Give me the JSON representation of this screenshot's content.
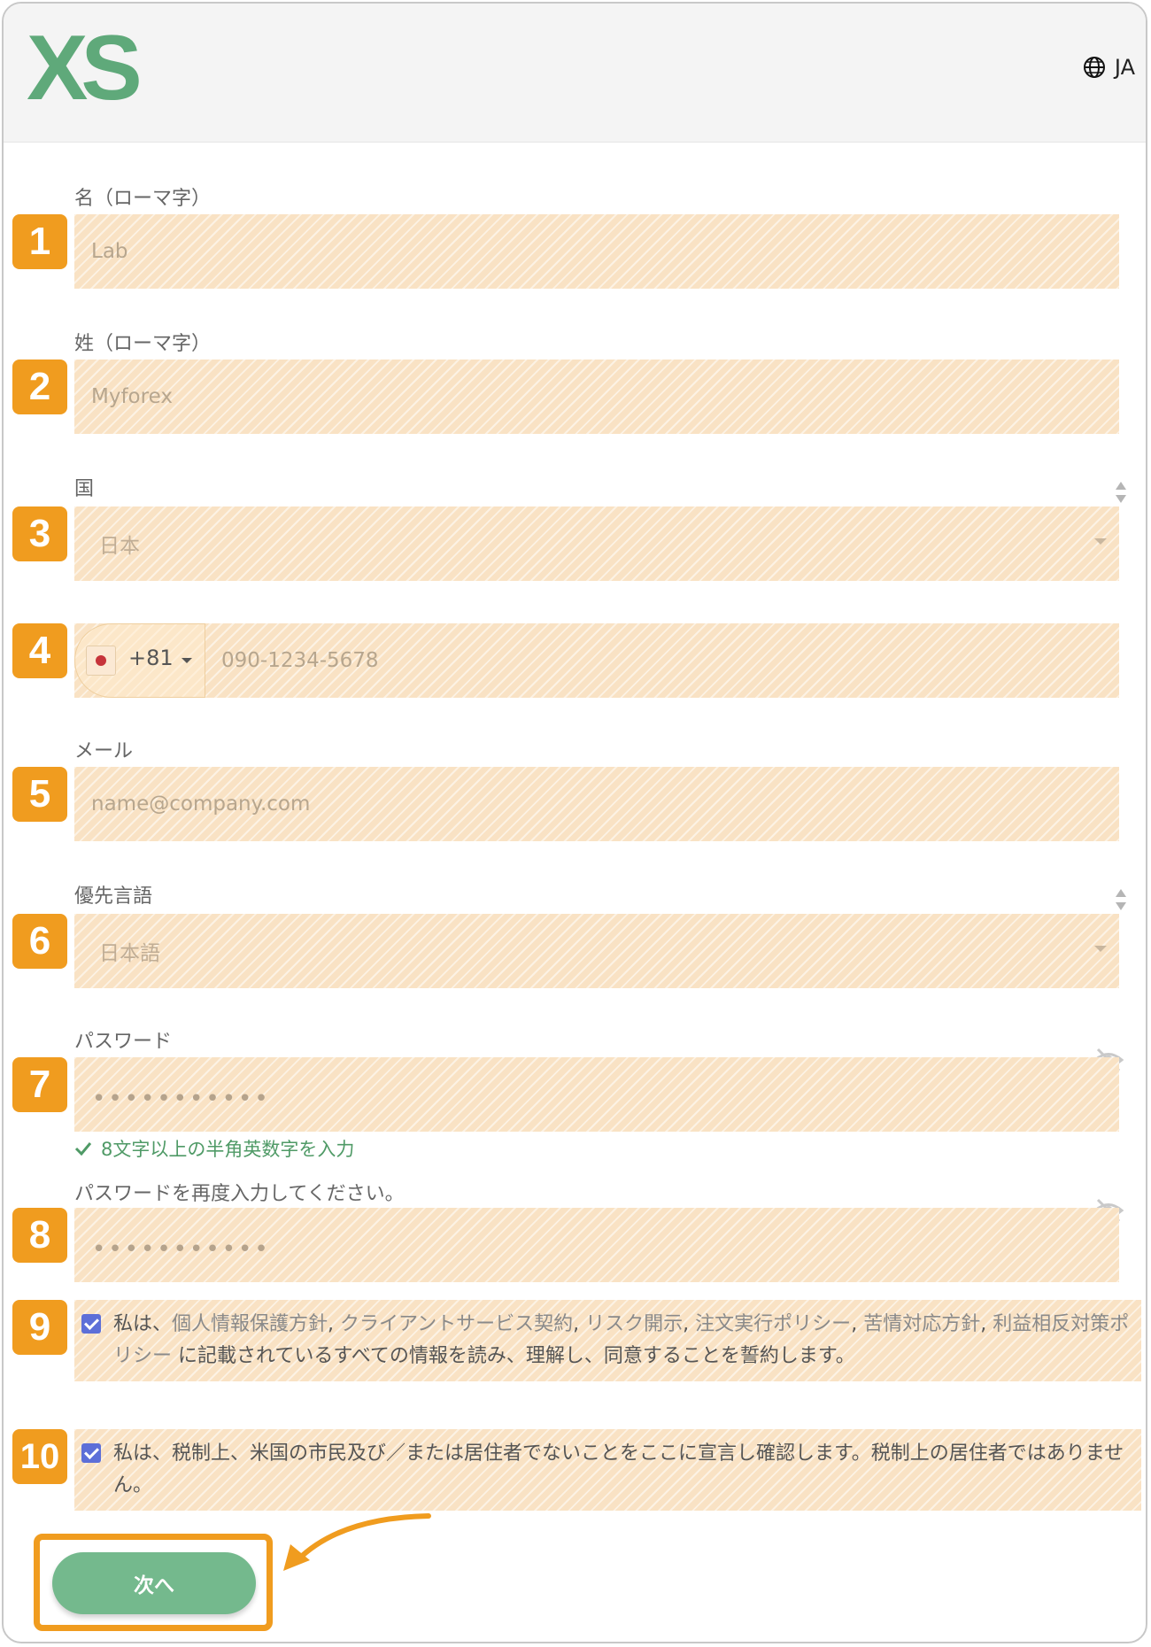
{
  "header": {
    "logo_text": "XS",
    "language": "JA"
  },
  "form": {
    "first_name": {
      "badge": "1",
      "label": "名（ローマ字）",
      "value": "Lab"
    },
    "last_name": {
      "badge": "2",
      "label": "姓（ローマ字）",
      "value": "Myforex"
    },
    "country": {
      "badge": "3",
      "label": "国",
      "value": "日本"
    },
    "phone": {
      "badge": "4",
      "dial_code": "+81",
      "placeholder": "090-1234-5678"
    },
    "email": {
      "badge": "5",
      "label": "メール",
      "placeholder": "name@company.com"
    },
    "preferred_language": {
      "badge": "6",
      "label": "優先言語",
      "value": "日本語"
    },
    "password": {
      "badge": "7",
      "label": "パスワード",
      "masked": "•••••••••••",
      "hint": "8文字以上の半角英数字を入力"
    },
    "password_confirm": {
      "badge": "8",
      "label": "パスワードを再度入力してください。",
      "masked": "•••••••••••"
    },
    "agreement": {
      "badge": "9",
      "prefix": "私は、",
      "links": [
        "個人情報保護方針",
        "クライアントサービス契約",
        "リスク開示",
        "注文実行ポリシー",
        "苦情対応方針",
        "利益相反対策ポリシー"
      ],
      "separator": ",",
      "suffix": " に記載されているすべての情報を読み、理解し、同意することを誓約します。"
    },
    "tax_declaration": {
      "badge": "10",
      "text": "私は、税制上、米国の市民及び／または居住者でないことをここに宣言し確認します。税制上の居住者ではありません。"
    },
    "next_button": "次へ"
  },
  "colors": {
    "accent_green": "#74b98d",
    "highlight_orange": "#f09c1f",
    "field_fill": "#f9e2c4",
    "checkbox_blue": "#5d6fd8"
  }
}
